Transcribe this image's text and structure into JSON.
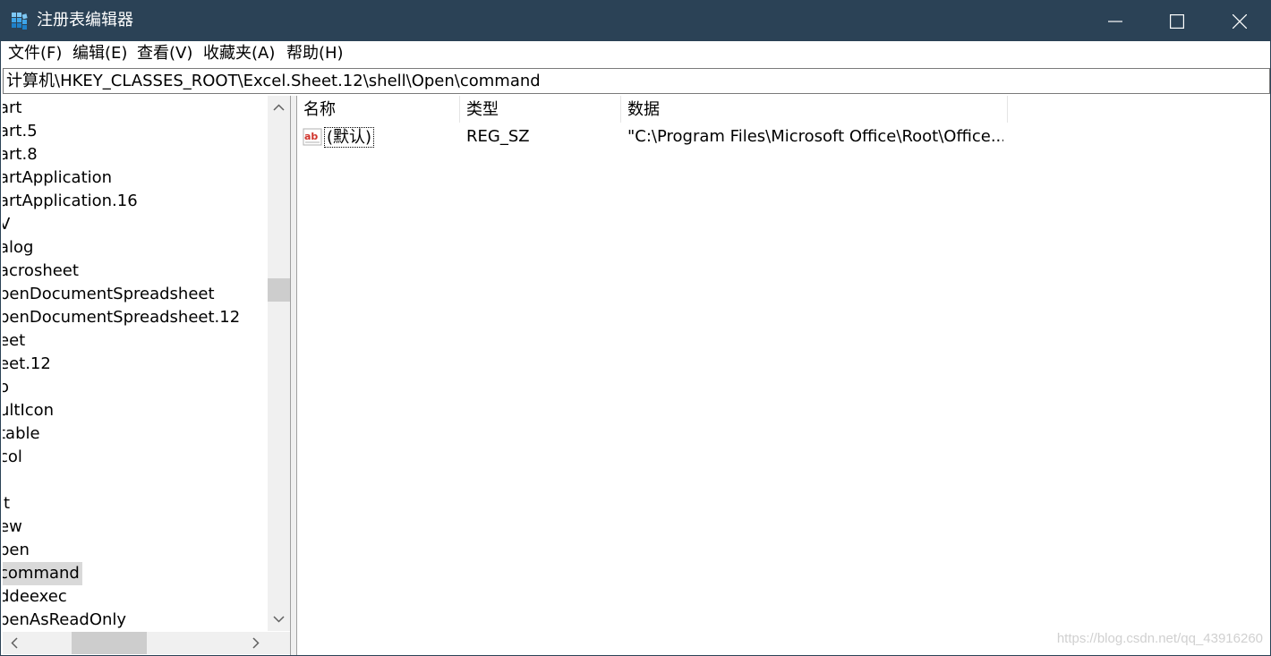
{
  "window": {
    "title": "注册表编辑器"
  },
  "menu": {
    "items": [
      "文件(F)",
      "编辑(E)",
      "查看(V)",
      "收藏夹(A)",
      "帮助(H)"
    ]
  },
  "address": {
    "path": "计算机\\HKEY_CLASSES_ROOT\\Excel.Sheet.12\\shell\\Open\\command"
  },
  "tree": {
    "items": [
      "art",
      "art.5",
      "art.8",
      "artApplication",
      "artApplication.16",
      "V",
      "alog",
      "acrosheet",
      "penDocumentSpreadsheet",
      "penDocumentSpreadsheet.12",
      "eet",
      "eet.12",
      "o",
      "ultIcon",
      "table",
      "col",
      "",
      "it",
      "ew",
      "pen",
      "command",
      "ddeexec",
      "penAsReadOnly"
    ],
    "selected_index": 20
  },
  "values": {
    "columns": [
      "名称",
      "类型",
      "数据"
    ],
    "rows": [
      {
        "name": "(默认)",
        "type": "REG_SZ",
        "data": "\"C:\\Program Files\\Microsoft Office\\Root\\Office..."
      }
    ]
  },
  "watermark": "https://blog.csdn.net/qq_43916260",
  "colors": {
    "titlebar": "#2b4256",
    "selection": "#d9d9d9",
    "scrollbar": "#f0f0f0",
    "scroll_thumb": "#cdcdcd"
  },
  "icons": {
    "app": "registry-editor-icon",
    "value": "string-value-icon"
  }
}
